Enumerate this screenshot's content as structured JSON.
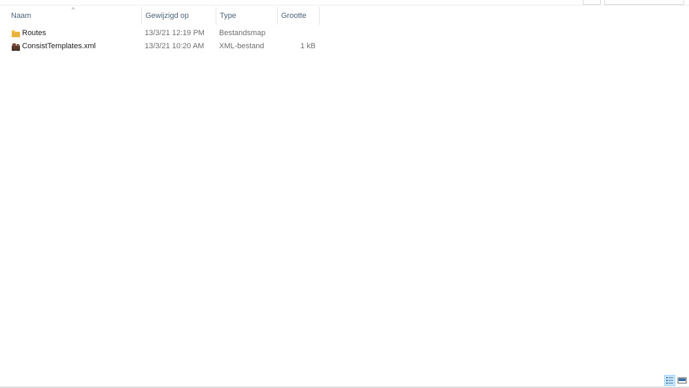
{
  "columns": {
    "name": "Naam",
    "modified": "Gewijzigd op",
    "type": "Type",
    "size": "Grootte"
  },
  "sort_indicator": "^",
  "files": [
    {
      "name": "Routes",
      "modified": "13/3/21 12:19 PM",
      "type": "Bestandsmap",
      "size": "",
      "icon": "folder-icon"
    },
    {
      "name": "ConsistTemplates.xml",
      "modified": "13/3/21 10:20 AM",
      "type": "XML-bestand",
      "size": "1 kB",
      "icon": "xml-file-icon"
    }
  ],
  "view_modes": {
    "active": "details",
    "icons": [
      "details-view-icon",
      "large-icons-view-icon"
    ]
  },
  "colors": {
    "header_text": "#4c607a",
    "secondary_text": "#6d6d6d",
    "selected_view": "#cce8ff",
    "folder": "#e8b33a"
  }
}
